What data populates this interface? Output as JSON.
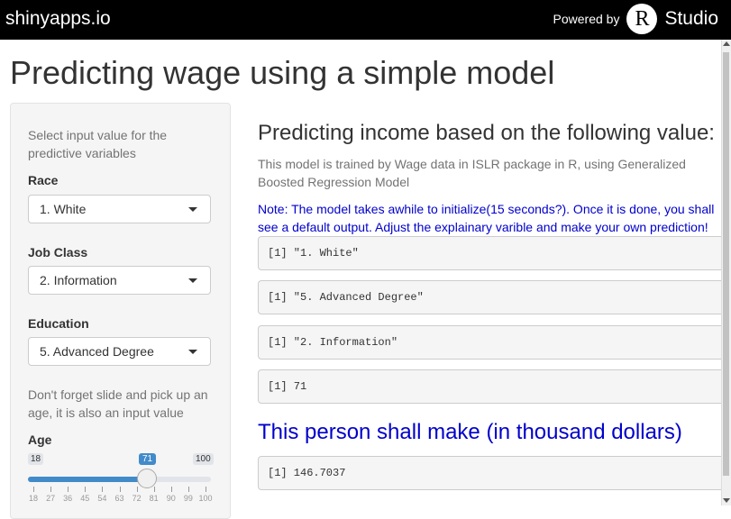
{
  "header": {
    "brand": "shinyapps.io",
    "powered_by": "Powered by",
    "r_letter": "R",
    "studio": "Studio"
  },
  "page_title": "Predicting wage using a simple model",
  "sidebar": {
    "intro": "Select input value for the predictive variables",
    "race": {
      "label": "Race",
      "value": "1. White"
    },
    "jobclass": {
      "label": "Job Class",
      "value": "2. Information"
    },
    "education": {
      "label": "Education",
      "value": "5. Advanced Degree"
    },
    "slider_note": "Don't forget slide and pick up an age, it is also an input value",
    "age": {
      "label": "Age",
      "min": "18",
      "max": "100",
      "value": "71",
      "value_fraction": 0.65,
      "ticks": [
        "18",
        "27",
        "36",
        "45",
        "54",
        "63",
        "72",
        "81",
        "90",
        "99",
        "100"
      ]
    }
  },
  "main": {
    "heading": "Predicting income based on the following value:",
    "description": "This model is trained by Wage data in ISLR package in R, using Generalized Boosted Regression Model",
    "note": "Note: The model takes awhile to initialize(15 seconds?). Once it is done, you shall see a default output. Adjust the explainary varible and make your own prediction!",
    "outputs": [
      "[1] \"1. White\"",
      "[1] \"5. Advanced Degree\"",
      "[1] \"2. Information\"",
      "[1] 71"
    ],
    "result_heading": "This person shall make (in thousand dollars)",
    "result": "[1] 146.7037"
  },
  "colors": {
    "accent": "#428bca",
    "note": "#0000cc"
  }
}
